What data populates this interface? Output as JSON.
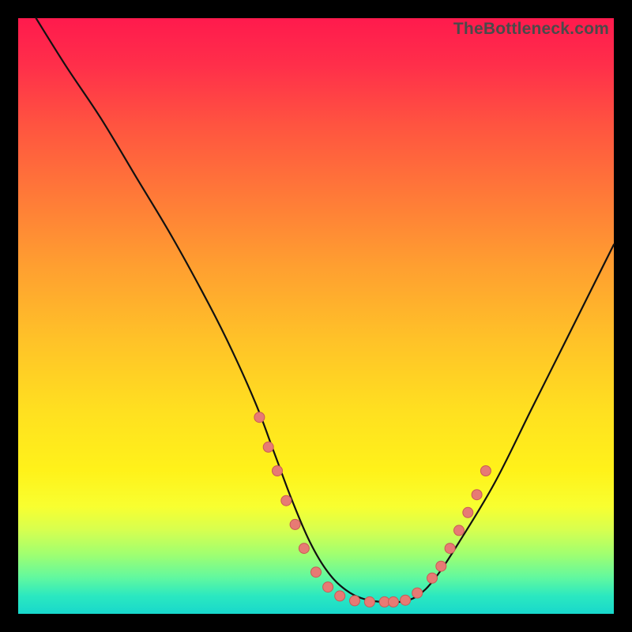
{
  "watermark": "TheBottleneck.com",
  "colors": {
    "page_bg": "#000000",
    "curve_stroke": "#111111",
    "marker_fill": "#e77a74",
    "marker_stroke": "#c95a55"
  },
  "chart_data": {
    "type": "line",
    "title": "",
    "xlabel": "",
    "ylabel": "",
    "xlim": [
      0,
      100
    ],
    "ylim": [
      0,
      100
    ],
    "grid": false,
    "legend": false,
    "series": [
      {
        "name": "curve",
        "x": [
          3,
          8,
          14,
          20,
          26,
          32,
          36,
          40,
          43,
          46,
          49,
          52,
          55,
          58,
          61,
          64,
          67,
          70,
          74,
          80,
          86,
          92,
          100
        ],
        "y": [
          100,
          92,
          83,
          73,
          63,
          52,
          44,
          35,
          27,
          19,
          12,
          7,
          4,
          2.5,
          2,
          2,
          3,
          6,
          12,
          22,
          34,
          46,
          62
        ]
      }
    ],
    "markers": [
      {
        "x": 40.5,
        "y": 33
      },
      {
        "x": 42.0,
        "y": 28
      },
      {
        "x": 43.5,
        "y": 24
      },
      {
        "x": 45.0,
        "y": 19
      },
      {
        "x": 46.5,
        "y": 15
      },
      {
        "x": 48.0,
        "y": 11
      },
      {
        "x": 50.0,
        "y": 7
      },
      {
        "x": 52.0,
        "y": 4.5
      },
      {
        "x": 54.0,
        "y": 3
      },
      {
        "x": 56.5,
        "y": 2.2
      },
      {
        "x": 59.0,
        "y": 2
      },
      {
        "x": 61.5,
        "y": 2
      },
      {
        "x": 63.0,
        "y": 2
      },
      {
        "x": 65.0,
        "y": 2.3
      },
      {
        "x": 67.0,
        "y": 3.5
      },
      {
        "x": 69.5,
        "y": 6
      },
      {
        "x": 71.0,
        "y": 8
      },
      {
        "x": 72.5,
        "y": 11
      },
      {
        "x": 74.0,
        "y": 14
      },
      {
        "x": 75.5,
        "y": 17
      },
      {
        "x": 77.0,
        "y": 20
      },
      {
        "x": 78.5,
        "y": 24
      }
    ]
  }
}
